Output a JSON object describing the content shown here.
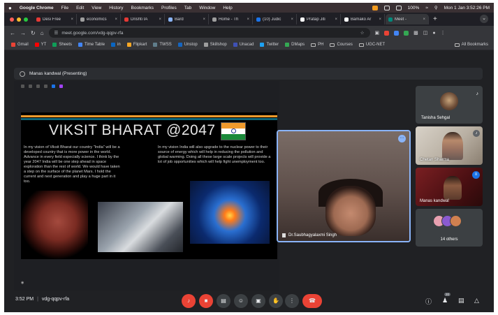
{
  "menubar": {
    "apple": "",
    "app": "Google Chrome",
    "items": [
      "File",
      "Edit",
      "View",
      "History",
      "Bookmarks",
      "Profiles",
      "Tab",
      "Window",
      "Help"
    ],
    "battery": "100%",
    "clock": "Mon 1 Jan  3:52:26 PM"
  },
  "tabs": [
    {
      "title": "Desi Free",
      "color": "#e53935"
    },
    {
      "title": "economics",
      "color": "#9e9e9e"
    },
    {
      "title": "Drishti IA",
      "color": "#e53935"
    },
    {
      "title": "Bard",
      "color": "#8ab4f8"
    },
    {
      "title": "Home - Th",
      "color": "#9e9e9e"
    },
    {
      "title": "(10) Judic",
      "color": "#1a73e8"
    },
    {
      "title": "Pratap Jiti",
      "color": "#ffffff"
    },
    {
      "title": "Bamako Ar",
      "color": "#ffffff"
    },
    {
      "title": "Meet -",
      "color": "#00897b",
      "active": true
    }
  ],
  "address": {
    "url": "meet.google.com/vdg-qqpv-rfa"
  },
  "bookmarks": [
    {
      "label": "Gmail",
      "color": "#ea4335"
    },
    {
      "label": "YT",
      "color": "#ff0000"
    },
    {
      "label": "Sheets",
      "color": "#0f9d58"
    },
    {
      "label": "Time Table",
      "color": "#4285f4"
    },
    {
      "label": "in",
      "color": "#0a66c2"
    },
    {
      "label": "Flipkart",
      "color": "#f9a825"
    },
    {
      "label": "TWSS",
      "color": "#607d8b"
    },
    {
      "label": "Unstop",
      "color": "#1565c0"
    },
    {
      "label": "Skillshop",
      "color": "#9e9e9e"
    },
    {
      "label": "Unacad",
      "color": "#3f51b5"
    },
    {
      "label": "Twitter",
      "color": "#1da1f2"
    },
    {
      "label": "DMaps",
      "color": "#34a853"
    },
    {
      "label": "PH",
      "color": "folder"
    },
    {
      "label": "Courses",
      "color": "folder"
    },
    {
      "label": "UGC-NET",
      "color": "folder"
    }
  ],
  "bookmarks_all": "All Bookmarks",
  "presenter": {
    "label": "Manas kandwal (Presenting)"
  },
  "slide": {
    "title": "VIKSIT BHARAT @2047",
    "left_text": "In my vision of Viksit Bharat our country \"India\" will be a developed country that is more power in the world. Advance in every field especially science. I think by the year 2047 India will be one step ahead in space exploration than the rest of world. We would have taken a step on the surface of the planet Mars. I hold the current and next generation and play a huge part in it too.",
    "right_text": "In my vision India will also upgrade to the nuclear power to their source of energy which will help in reducing the pollution and global warming. Doing all these large scale projects will provide a lot of job opportunities which will help fight unemployment too.",
    "stripe_colors": [
      "#f09a2c",
      "#1aa8c8"
    ]
  },
  "speaker": {
    "name": "Dr.Saubhagyalaxmi Singh"
  },
  "participants": [
    {
      "name": "Tanisha Sehgal"
    },
    {
      "name": "Chetan Sharma"
    },
    {
      "name": "Manas kandwal"
    }
  ],
  "others": {
    "label": "14 others",
    "avatar_colors": [
      "#e8a0b0",
      "#8a5ad0",
      "#d08050"
    ]
  },
  "meeting": {
    "time": "3:52 PM",
    "code": "vdg-qqpv-rfa"
  },
  "participant_count": "20"
}
